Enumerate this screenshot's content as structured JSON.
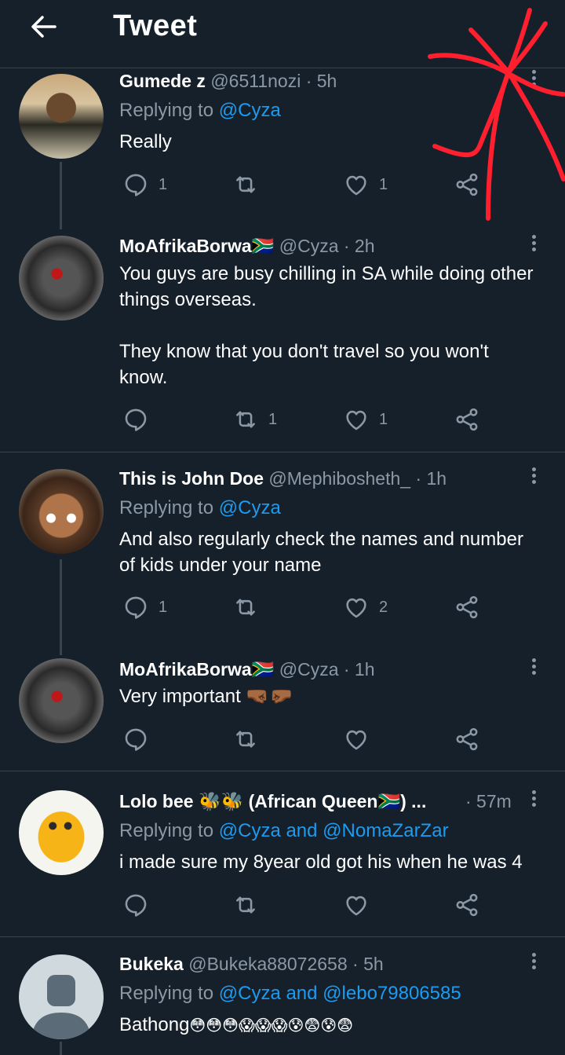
{
  "header": {
    "title": "Tweet",
    "back_icon": "arrow-left-icon"
  },
  "replies": [
    {
      "name": "Gumede z",
      "handle": "@6511nozi",
      "time": "· 5h",
      "replying_prefix": "Replying to ",
      "replying_to": "@Cyza",
      "text": "Really",
      "reply_count": "1",
      "retweet_count": "",
      "like_count": "1"
    },
    {
      "name": "MoAfrikaBorwa",
      "flag": "🇿🇦",
      "handle": "@Cyza",
      "time": "· 2h",
      "text_line1": "You guys are busy chilling in SA while doing other",
      "text_line2": "things overseas.",
      "text_line3": "They know that you don't travel so you won't",
      "text_line4": "know.",
      "reply_count": "",
      "retweet_count": "1",
      "like_count": "1"
    },
    {
      "name": "This is John Doe",
      "handle": "@Mephibosheth_",
      "time": "· 1h",
      "replying_prefix": "Replying to ",
      "replying_to": "@Cyza",
      "text_line1": "And also regularly check the names and number",
      "text_line2": "of kids under your name",
      "reply_count": "1",
      "retweet_count": "",
      "like_count": "2"
    },
    {
      "name": "MoAfrikaBorwa",
      "flag": "🇿🇦",
      "handle": "@Cyza",
      "time": "· 1h",
      "text": "Very important ",
      "text_emoji": "🤜🏾🤛🏾",
      "reply_count": "",
      "retweet_count": "",
      "like_count": ""
    },
    {
      "name": "Lolo bee 🐝🐝 (African Queen🇿🇦) ...",
      "handle": "",
      "time": "· 57m",
      "replying_prefix": "Replying to ",
      "replying_to": "@Cyza and @NomaZarZar",
      "text": "i made sure my 8year old got his when he was 4",
      "reply_count": "",
      "retweet_count": "",
      "like_count": ""
    },
    {
      "name": "Bukeka",
      "handle": "@Bukeka88072658",
      "time": "· 5h",
      "replying_prefix": "Replying to ",
      "replying_to": "@Cyza and @lebo79806585",
      "text": "Bathong",
      "text_emoji": "😳😳😳😱😱😱😰😨😰😨"
    }
  ],
  "icons": {
    "reply": "reply-icon",
    "retweet": "retweet-icon",
    "like": "heart-icon",
    "share": "share-icon",
    "more": "more-vertical-icon"
  },
  "colors": {
    "background": "#15202b",
    "link": "#1d9bf0",
    "secondary_text": "#8b98a5",
    "divider": "#38444d",
    "annotation": "#ff1f2e"
  }
}
